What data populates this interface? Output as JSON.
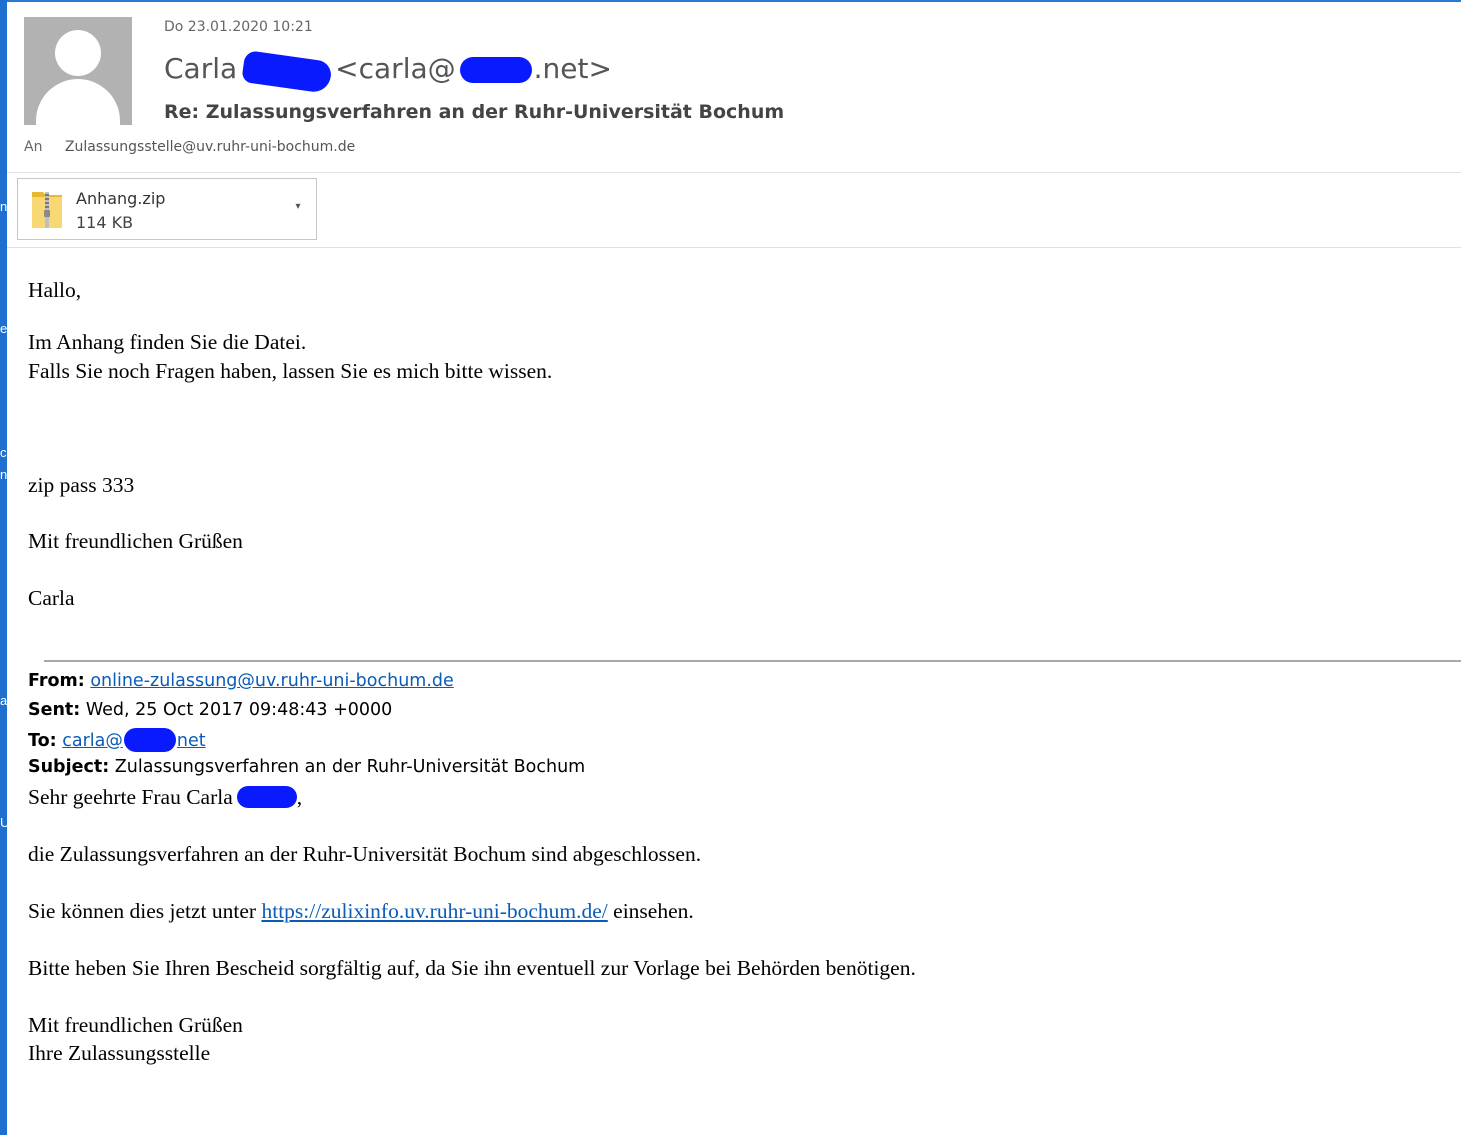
{
  "window": {
    "accent_color": "#1e6fcf"
  },
  "header": {
    "date": "Do 23.01.2020 10:21",
    "sender_first": "Carla",
    "sender_email_prefix": "<carla@",
    "sender_email_suffix": ".net>",
    "subject": "Re: Zulassungsverfahren an der Ruhr-Universität Bochum",
    "to_label": "An",
    "to_address": "Zulassungsstelle@uv.ruhr-uni-bochum.de",
    "avatar_icon": "person-silhouette-icon"
  },
  "attachment": {
    "name": "Anhang.zip",
    "size": "114 KB",
    "icon": "zip-folder-icon",
    "dropdown_icon": "chevron-down-icon"
  },
  "body": {
    "greeting": "Hallo,",
    "line1": "Im Anhang finden Sie die Datei.",
    "line2": "Falls Sie noch Fragen haben, lassen Sie es mich bitte wissen.",
    "zip_pass": "zip pass 333",
    "closing": "Mit freundlichen Grüßen",
    "signature": "Carla"
  },
  "quoted": {
    "from_label": "From:",
    "from_value": "online-zulassung@uv.ruhr-uni-bochum.de",
    "sent_label": "Sent:",
    "sent_value": "Wed, 25 Oct 2017 09:48:43 +0000",
    "to_label": "To:",
    "to_prefix": "carla@",
    "to_suffix": "net",
    "subject_label": "Subject:",
    "subject_value": "Zulassungsverfahren an der Ruhr-Universität Bochum",
    "salutation": "Sehr geehrte Frau Carla",
    "salutation_end": ",",
    "para1": "die Zulassungsverfahren an der Ruhr-Universität Bochum sind abgeschlossen.",
    "para2_before": "Sie können dies jetzt unter",
    "para2_link": "https://zulixinfo.uv.ruhr-uni-bochum.de/",
    "para2_after": "einsehen.",
    "para3": "Bitte heben Sie Ihren Bescheid sorgfältig auf, da Sie ihn eventuell zur Vorlage bei Behörden benötigen.",
    "closing1": "Mit freundlichen Grüßen",
    "closing2": "Ihre Zulassungsstelle"
  }
}
